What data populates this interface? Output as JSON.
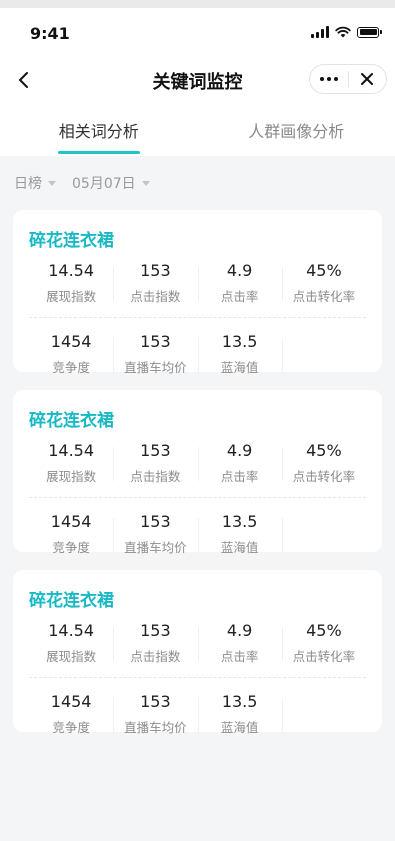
{
  "status_bar": {
    "time": "9:41"
  },
  "navbar": {
    "title": "关键词监控"
  },
  "tabs": [
    {
      "label": "相关词分析",
      "active": true
    },
    {
      "label": "人群画像分析",
      "active": false
    }
  ],
  "filters": {
    "period": "日榜",
    "date": "05月07日"
  },
  "colors": {
    "accent": "#1ec5c9",
    "keyword": "#16b9c4"
  },
  "cards": [
    {
      "keyword": "碎花连衣裙",
      "row1": [
        {
          "value": "14.54",
          "label": "展现指数"
        },
        {
          "value": "153",
          "label": "点击指数"
        },
        {
          "value": "4.9",
          "label": "点击率"
        },
        {
          "value": "45%",
          "label": "点击转化率"
        }
      ],
      "row2": [
        {
          "value": "1454",
          "label": "竞争度"
        },
        {
          "value": "153",
          "label": "直播车均价"
        },
        {
          "value": "13.5",
          "label": "蓝海值"
        }
      ]
    },
    {
      "keyword": "碎花连衣裙",
      "row1": [
        {
          "value": "14.54",
          "label": "展现指数"
        },
        {
          "value": "153",
          "label": "点击指数"
        },
        {
          "value": "4.9",
          "label": "点击率"
        },
        {
          "value": "45%",
          "label": "点击转化率"
        }
      ],
      "row2": [
        {
          "value": "1454",
          "label": "竞争度"
        },
        {
          "value": "153",
          "label": "直播车均价"
        },
        {
          "value": "13.5",
          "label": "蓝海值"
        }
      ]
    },
    {
      "keyword": "碎花连衣裙",
      "row1": [
        {
          "value": "14.54",
          "label": "展现指数"
        },
        {
          "value": "153",
          "label": "点击指数"
        },
        {
          "value": "4.9",
          "label": "点击率"
        },
        {
          "value": "45%",
          "label": "点击转化率"
        }
      ],
      "row2": [
        {
          "value": "1454",
          "label": "竞争度"
        },
        {
          "value": "153",
          "label": "直播车均价"
        },
        {
          "value": "13.5",
          "label": "蓝海值"
        }
      ]
    }
  ]
}
